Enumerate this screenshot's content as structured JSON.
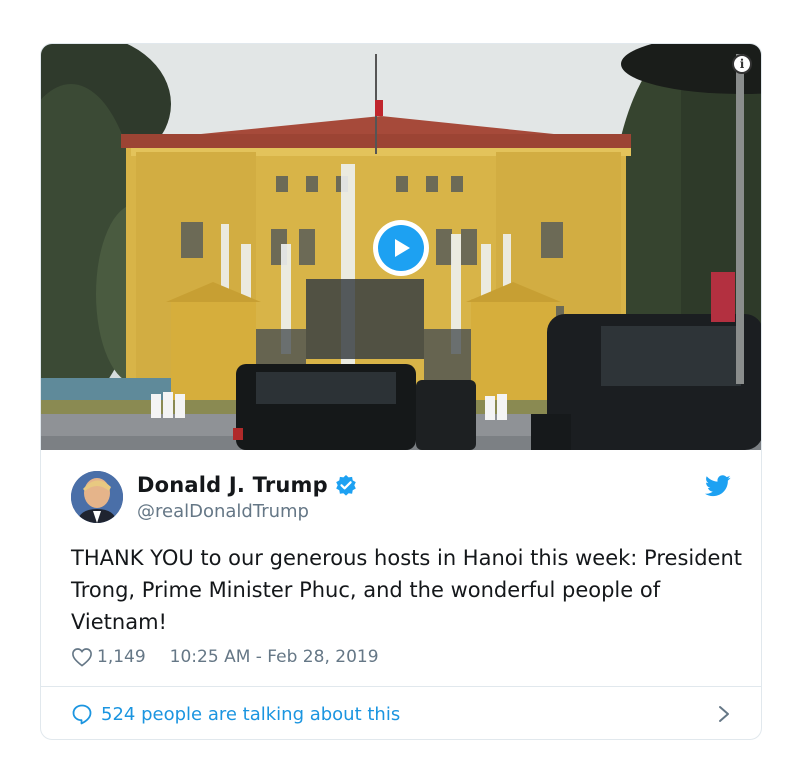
{
  "media": {
    "play_icon": "play-icon",
    "info_icon": "info-icon",
    "accent": "#1da1f2"
  },
  "author": {
    "display_name": "Donald J. Trump",
    "handle": "@realDonaldTrump",
    "verified": true,
    "verified_icon": "verified-badge-icon"
  },
  "tweet": {
    "text": "THANK YOU to our generous hosts in Hanoi this week: President Trong, Prime Minister Phuc, and the wonderful people of Vietnam!",
    "likes": "1,149",
    "timestamp": "10:25 AM - Feb 28, 2019"
  },
  "footer": {
    "talking_label": "524 people are talking about this"
  },
  "colors": {
    "link_blue": "#1b95e0",
    "muted": "#657786",
    "border": "#e1e8ed"
  }
}
